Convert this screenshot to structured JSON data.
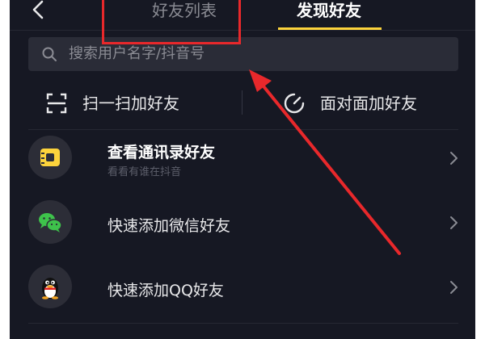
{
  "header": {
    "tabs": [
      {
        "label": "好友列表",
        "active": false
      },
      {
        "label": "发现好友",
        "active": true
      }
    ],
    "accent_color": "#fcd33c"
  },
  "search": {
    "placeholder": "搜索用户名字/抖音号"
  },
  "quick_actions": [
    {
      "label": "扫一扫加好友",
      "icon": "scan-icon"
    },
    {
      "label": "面对面加好友",
      "icon": "face-to-face-icon"
    }
  ],
  "list": [
    {
      "title": "查看通讯录好友",
      "subtitle": "看看有谁在抖音",
      "icon": "contacts-icon"
    },
    {
      "title": "快速添加微信好友",
      "icon": "wechat-icon"
    },
    {
      "title": "快速添加QQ好友",
      "icon": "qq-icon"
    }
  ],
  "colors": {
    "background": "#161823",
    "annotation": "#e8282b"
  }
}
